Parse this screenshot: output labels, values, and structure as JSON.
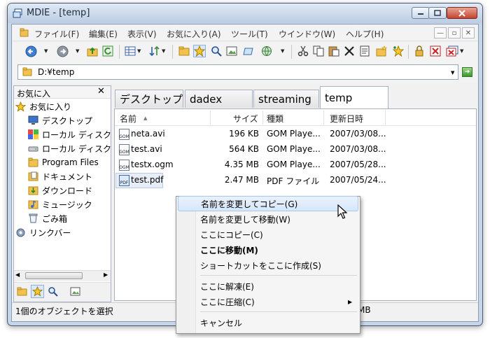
{
  "window": {
    "title": "MDIE - [temp]"
  },
  "menubar": {
    "items": [
      "ファイル(F)",
      "編集(E)",
      "表示(V)",
      "お気に入り(A)",
      "ツール(T)",
      "ウインドウ(W)",
      "ヘルプ(H)"
    ]
  },
  "address": {
    "path": "D:¥temp"
  },
  "left_pane": {
    "title": "お気に入",
    "tree": [
      {
        "label": "お気に入り",
        "icon": "star-icon"
      },
      {
        "label": "デスクトップ",
        "icon": "desktop-icon"
      },
      {
        "label": "ローカル ディスク",
        "icon": "local-disk-icon"
      },
      {
        "label": "ローカル ディスク",
        "icon": "local-disk-icon"
      },
      {
        "label": "Program Files",
        "icon": "folder-icon"
      },
      {
        "label": "ドキュメント",
        "icon": "documents-icon"
      },
      {
        "label": "ダウンロード",
        "icon": "downloads-icon"
      },
      {
        "label": "ミュージック",
        "icon": "music-icon"
      },
      {
        "label": "ごみ箱",
        "icon": "recycle-bin-icon"
      },
      {
        "label": "リンクバー",
        "icon": "gear-icon"
      }
    ]
  },
  "tabs": [
    "デスクトップ",
    "dadex",
    "streaming",
    "temp"
  ],
  "file_list": {
    "columns": [
      "名前",
      "サイズ",
      "種類",
      "更新日時"
    ],
    "rows": [
      {
        "name": "neta.avi",
        "size": "196 KB",
        "type": "GOM Playe...",
        "date": "2007/03/08..."
      },
      {
        "name": "test.avi",
        "size": "564 KB",
        "type": "GOM Playe...",
        "date": "2007/03/08..."
      },
      {
        "name": "testx.ogm",
        "size": "4.35 MB",
        "type": "GOM Playe...",
        "date": "2007/05/28..."
      },
      {
        "name": "test.pdf",
        "size": "2.47 MB",
        "type": "PDF ファイル",
        "date": "2007/05/24..."
      }
    ]
  },
  "context_menu": {
    "items": [
      "名前を変更してコピー(G)",
      "名前を変更して移動(W)",
      "ここにコピー(C)",
      "ここに移動(M)",
      "ショートカットをここに作成(S)",
      "ここに解凍(E)",
      "ここに圧縮(C)",
      "キャンセル"
    ]
  },
  "status": {
    "text": "1個のオブジェクトを選択",
    "size_fragment": "MB"
  }
}
